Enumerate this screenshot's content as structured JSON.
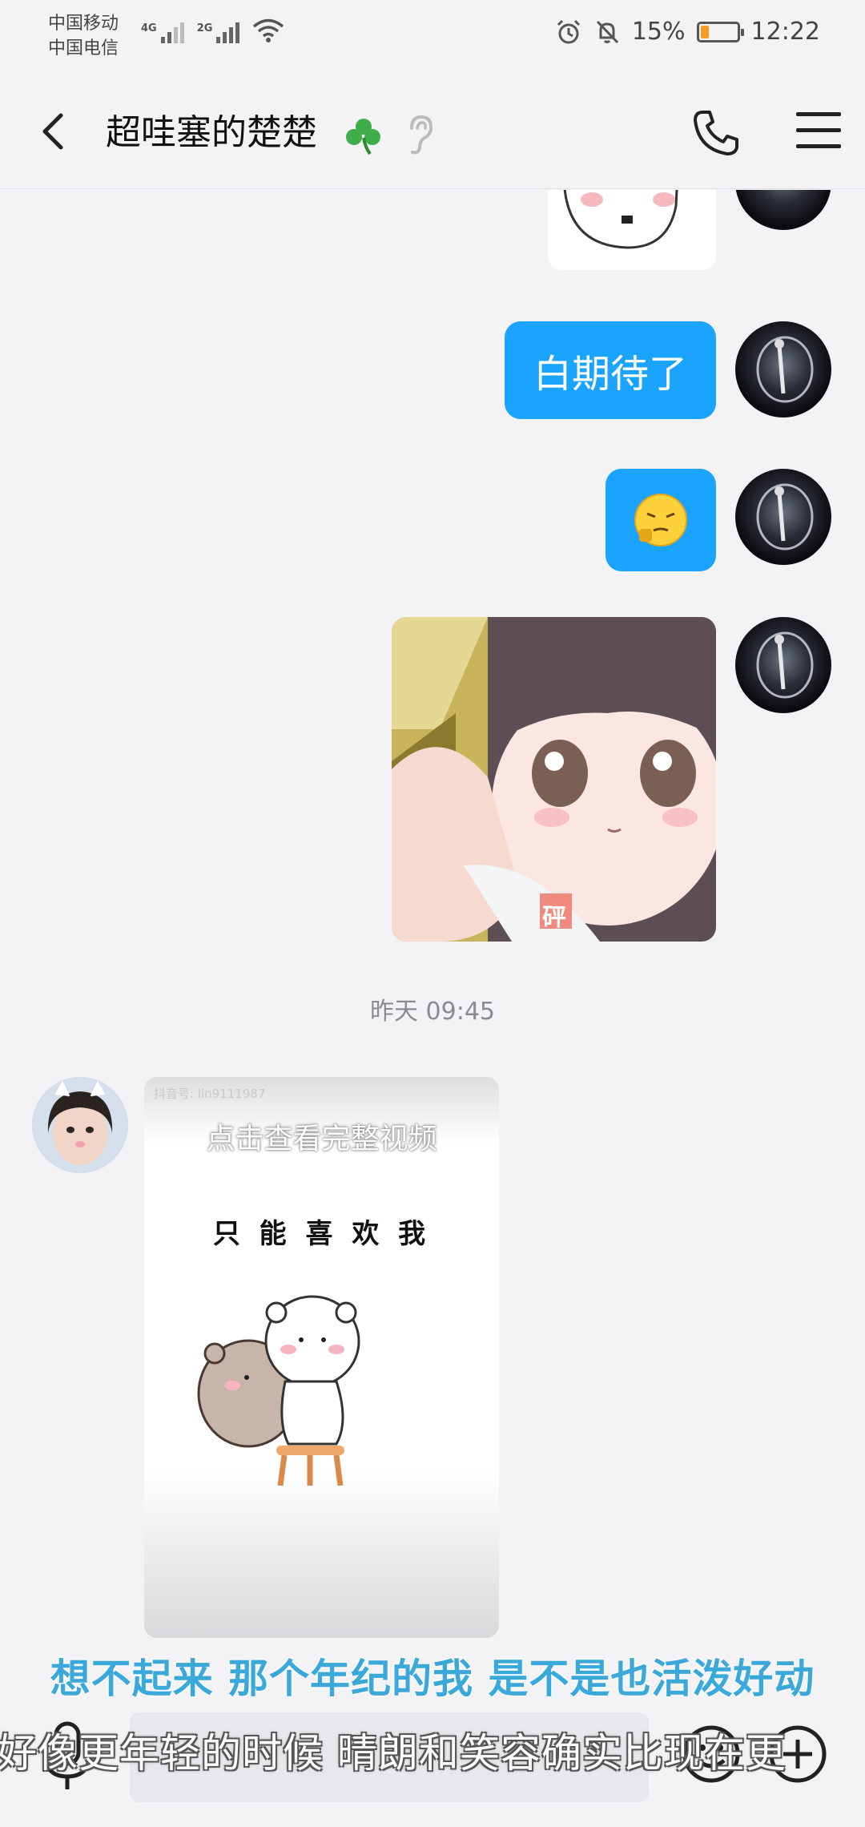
{
  "status_bar": {
    "carrier_1": "中国移动",
    "carrier_2": "中国电信",
    "net_1": "4G",
    "net_2": "2G",
    "battery": "15%",
    "time": "12:22",
    "battery_level": 0.15,
    "battery_color": "#f59a23"
  },
  "header": {
    "title": "超哇塞的楚楚",
    "title_emoji": "clover-icon",
    "listen_icon": "ear-icon"
  },
  "messages": {
    "text_1": "白期待了",
    "emoji_2": "smirk-emoji",
    "image_3_stamp": "砰"
  },
  "timestamp": "昨天 09:45",
  "video": {
    "watermark": "抖音号: lin9111987",
    "overlay": "点击查看完整视频",
    "sticker_text": "只 能 喜 欢 我"
  },
  "lyrics": {
    "line_1": "想不起来 那个年纪的我 是不是也活泼好动",
    "line_2": "好像更年轻的时候 晴朗和笑容确实比现在更"
  },
  "input": {
    "placeholder": ""
  },
  "colors": {
    "bubble": "#1aa3ff",
    "lyric_primary": "#3aa8d8",
    "background": "#f3f3f5"
  }
}
